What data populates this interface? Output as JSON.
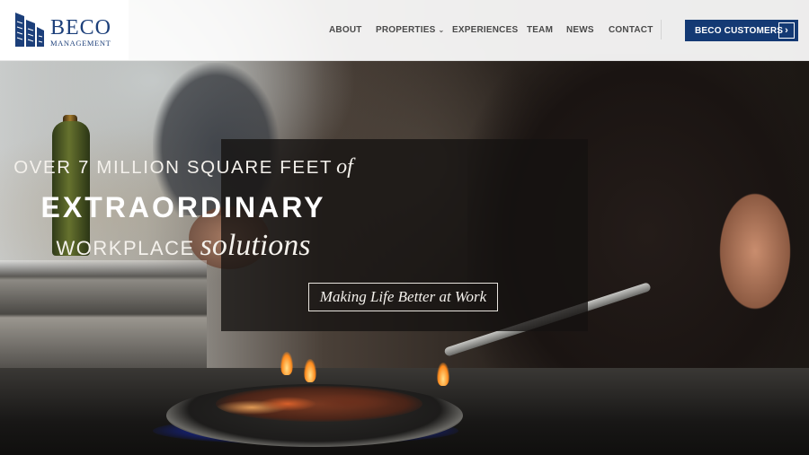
{
  "brand": {
    "name": "BECO",
    "subtitle": "MANAGEMENT",
    "color": "#1c3f7a"
  },
  "nav": {
    "items": [
      {
        "label": "ABOUT"
      },
      {
        "label": "PROPERTIES",
        "has_dropdown": true,
        "caret": "⌄"
      },
      {
        "label": "EXPERIENCES"
      },
      {
        "label": "TEAM"
      },
      {
        "label": "NEWS"
      },
      {
        "label": "CONTACT"
      }
    ]
  },
  "customers_button": {
    "label": "BECO CUSTOMERS",
    "arrow": "›",
    "color": "#143a74"
  },
  "hero": {
    "line1_caps": "OVER 7 MILLION SQUARE FEET",
    "line1_italic": "of",
    "line2": "EXTRAORDINARY",
    "line3_caps": "WORKPLACE",
    "line3_italic": "solutions",
    "tagline": "Making Life Better at Work"
  }
}
